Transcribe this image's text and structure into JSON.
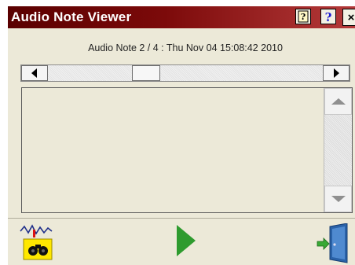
{
  "window": {
    "title": "Audio Note Viewer",
    "close_glyph": "×"
  },
  "note": {
    "header": "Audio Note 2 / 4 : Thu Nov 04 15:08:42 2010"
  },
  "scrollbar": {
    "position": 2,
    "total": 4
  },
  "toolbar": {
    "title_buttons": [
      "help-book-icon",
      "help-question-icon",
      "close-icon"
    ],
    "bottom_buttons": [
      "binoculars-folder-icon",
      "play-icon",
      "exit-door-icon"
    ]
  },
  "colors": {
    "titlebar": "#7c0a0a",
    "play": "#2e9b2e",
    "door": "#2a62a8"
  }
}
